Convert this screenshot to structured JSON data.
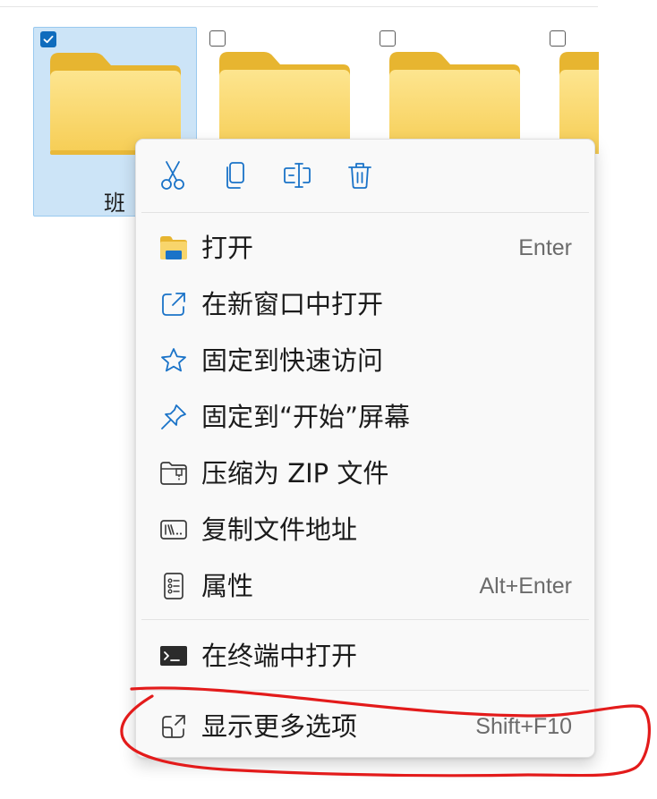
{
  "file_grid": {
    "items": [
      {
        "name": "班",
        "selected": true
      },
      {
        "name": "",
        "selected": false
      },
      {
        "name": "",
        "selected": false
      },
      {
        "name": "",
        "selected": false
      }
    ]
  },
  "context_menu": {
    "quick_actions": [
      {
        "icon": "scissors-icon",
        "action": "cut"
      },
      {
        "icon": "copy-icon",
        "action": "copy"
      },
      {
        "icon": "rename-icon",
        "action": "rename"
      },
      {
        "icon": "trash-icon",
        "action": "delete"
      }
    ],
    "items": [
      {
        "label": "打开",
        "shortcut": "Enter",
        "icon": "folder-open-icon"
      },
      {
        "label": "在新窗口中打开",
        "shortcut": "",
        "icon": "open-new-window-icon"
      },
      {
        "label": "固定到快速访问",
        "shortcut": "",
        "icon": "star-icon"
      },
      {
        "label": "固定到“开始”屏幕",
        "shortcut": "",
        "icon": "pin-icon"
      },
      {
        "label": "压缩为 ZIP 文件",
        "shortcut": "",
        "icon": "zip-icon"
      },
      {
        "label": "复制文件地址",
        "shortcut": "",
        "icon": "copy-path-icon"
      },
      {
        "label": "属性",
        "shortcut": "Alt+Enter",
        "icon": "properties-icon"
      },
      {
        "label": "在终端中打开",
        "shortcut": "",
        "icon": "terminal-icon"
      },
      {
        "label": "显示更多选项",
        "shortcut": "Shift+F10",
        "icon": "show-more-icon"
      }
    ]
  },
  "colors": {
    "selection_background": "#cce4f7",
    "selection_border": "#99c9ef",
    "checkbox_checked": "#0f6cbd",
    "folder_yellow": "#f8d56b",
    "icon_blue": "#1a73c8",
    "menu_background": "#f9f9f9",
    "annotation_red": "#e31b1b"
  }
}
